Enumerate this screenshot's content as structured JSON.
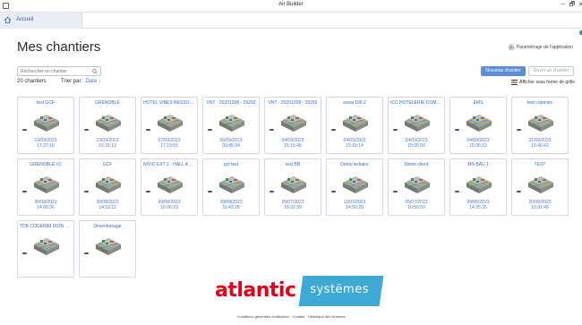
{
  "window": {
    "title": "Air Builder",
    "minimize": "–",
    "maximize": "🗗",
    "close": "✕"
  },
  "tabs": [
    {
      "label": "Accueil"
    }
  ],
  "header": {
    "title": "Mes chantiers",
    "settings_label": "Paramétrage de l'application"
  },
  "search": {
    "placeholder": "Rechercher un chantier"
  },
  "actions": {
    "new_label": "Nouveau chantier",
    "open_label": "Ouvrir un chantier"
  },
  "list": {
    "count": "20 chantiers",
    "sort_label": "Trier par :",
    "sort_value": "Date ↓",
    "grid_toggle": "Afficher sous forme de grille"
  },
  "projects": [
    {
      "name": "test GCF",
      "date": "13/09/2023",
      "time": "17:27:16"
    },
    {
      "name": "GRENOBLE",
      "date": "13/09/2023",
      "time": "15:31:13"
    },
    {
      "name": "HOTEL VIBES RESSORT - CI",
      "date": "07/09/2023",
      "time": "17:19:55"
    },
    {
      "name": "VNT - 20201208 - 29292",
      "date": "06/09/2023",
      "time": "09:45:34"
    },
    {
      "name": "VNT - 20201208 - 29292",
      "date": "04/09/2023",
      "time": "15:15:46"
    },
    {
      "name": "essai 108.2",
      "date": "04/09/2023",
      "time": "15:10:14"
    },
    {
      "name": "ICC HOTELERIE COMMODI...",
      "date": "04/09/2023",
      "time": "15:00:50"
    },
    {
      "name": "EMS",
      "date": "04/09/2023",
      "time": "15:06:53"
    },
    {
      "name": "test copenec",
      "date": "31/08/2023",
      "time": "15:40:43"
    },
    {
      "name": "GRENOBLE V2",
      "date": "30/08/2023",
      "time": "14:05:36"
    },
    {
      "name": "GCF",
      "date": "30/08/2023",
      "time": "14:53:11"
    },
    {
      "name": "NIVIO EXT 2 - HALL A B 1-2",
      "date": "29/08/2023",
      "time": "16:06:23"
    },
    {
      "name": "gcf test",
      "date": "28/08/2023",
      "time": "11:42:28"
    },
    {
      "name": "test BB",
      "date": "25/07/2023",
      "time": "16:22:39"
    },
    {
      "name": "Démo tertiaire",
      "date": "11/07/2023",
      "time": "14:50:29"
    },
    {
      "name": "Démo client",
      "date": "05/07/2023",
      "time": "10:50:59"
    },
    {
      "name": "MN BAU 1",
      "date": "28/06/2023",
      "time": "14:25:35"
    },
    {
      "name": "TEST",
      "date": "20/06/2023",
      "time": "10:31:46"
    },
    {
      "name": "TDB COGERIM DION DELOI",
      "date": "",
      "time": ""
    },
    {
      "name": "Desenfumage",
      "date": "",
      "time": ""
    }
  ],
  "footer": {
    "brand": "atlantic",
    "brand_sub": "systēmes",
    "links": "Conditions générales d'utilisation - Contact - Historique des versions"
  },
  "colors": {
    "accent": "#5b8fd6",
    "link": "#3a6cc0",
    "brand_red": "#e2001a",
    "brand_blue": "#3fa9d6"
  }
}
